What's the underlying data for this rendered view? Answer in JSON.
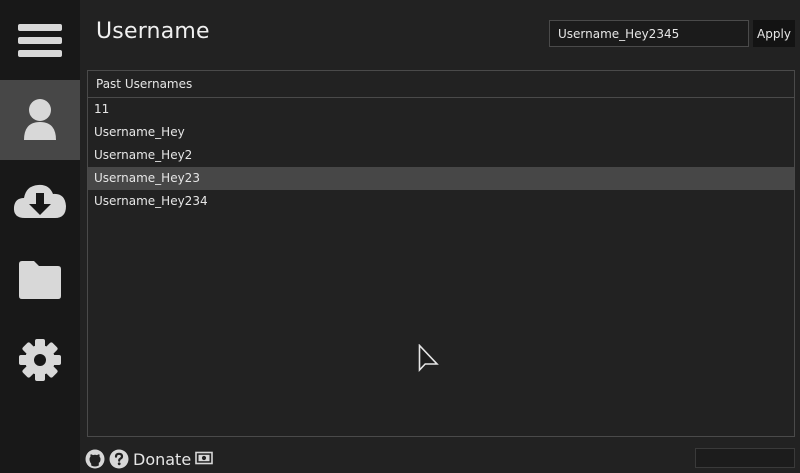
{
  "header": {
    "title": "Username",
    "username_value": "Username_Hey2345",
    "apply_label": "Apply"
  },
  "sidebar": {
    "items": [
      {
        "name": "menu",
        "icon": "hamburger-menu-icon"
      },
      {
        "name": "username",
        "icon": "user-icon",
        "active": true
      },
      {
        "name": "download",
        "icon": "cloud-download-icon"
      },
      {
        "name": "folder",
        "icon": "folder-icon"
      },
      {
        "name": "settings",
        "icon": "gear-icon"
      }
    ]
  },
  "list": {
    "header": "Past Usernames",
    "items": [
      "11",
      "Username_Hey",
      "Username_Hey2",
      "Username_Hey23",
      "Username_Hey234"
    ],
    "selected_index": 3
  },
  "footer": {
    "donate_label": "Donate",
    "icons": [
      "github-icon",
      "help-icon",
      "money-icon"
    ]
  },
  "colors": {
    "background": "#222222",
    "sidebar": "#181818",
    "active": "#474747",
    "text": "#e6e6e6",
    "border": "#4a4a4a"
  }
}
